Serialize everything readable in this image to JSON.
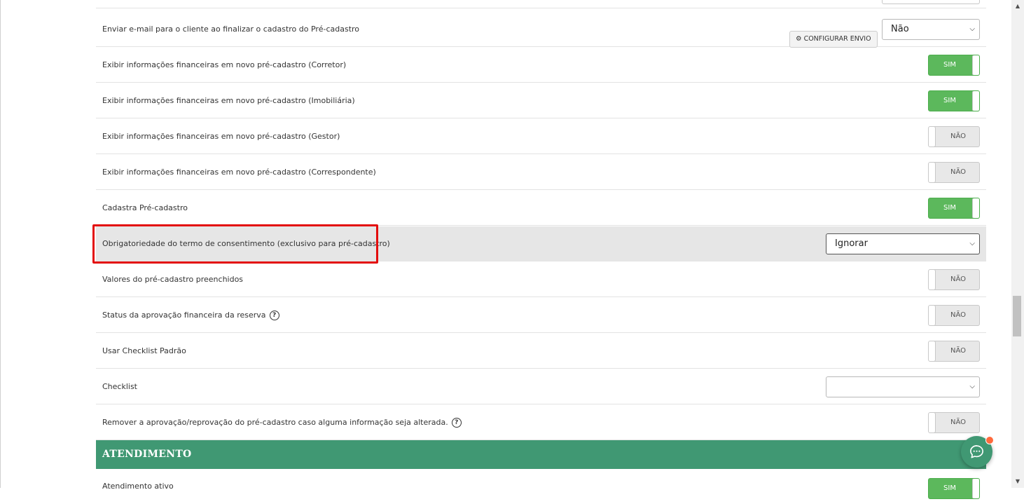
{
  "settings": [
    {
      "label": "Enviar e-mail para o cliente ao finalizar o cadastro do Pré-cadastro",
      "button": "CONFIGURAR ENVIO",
      "select": "Não"
    },
    {
      "label": "Exibir informações financeiras em novo pré-cadastro (Corretor)",
      "toggle": "SIM"
    },
    {
      "label": "Exibir informações financeiras em novo pré-cadastro (Imobiliária)",
      "toggle": "SIM"
    },
    {
      "label": "Exibir informações financeiras em novo pré-cadastro (Gestor)",
      "toggle": "NÃO"
    },
    {
      "label": "Exibir informações financeiras em novo pré-cadastro (Correspondente)",
      "toggle": "NÃO"
    },
    {
      "label": "Cadastra Pré-cadastro",
      "toggle": "SIM"
    },
    {
      "label": "Obrigatoriedade do termo de consentimento (exclusivo para pré-cadastro)",
      "select": "Ignorar"
    },
    {
      "label": "Valores do pré-cadastro preenchidos",
      "toggle": "NÃO"
    },
    {
      "label": "Status da aprovação financeira da reserva",
      "toggle": "NÃO",
      "help": "?"
    },
    {
      "label": "Usar Checklist Padrão",
      "toggle": "NÃO"
    },
    {
      "label": "Checklist",
      "select": ""
    },
    {
      "label": "Remover a aprovação/reprovação do pré-cadastro caso alguma informação seja alterada.",
      "toggle": "NÃO",
      "help": "?"
    }
  ],
  "section": {
    "title": "ATENDIMENTO"
  },
  "next_row": {
    "label": "Atendimento ativo",
    "toggle": "SIM"
  },
  "icons": {
    "gear": "gear-icon",
    "chevron": "chevron-down-icon",
    "help": "help-circle-icon",
    "chat": "chat-bubble-icon"
  },
  "colors": {
    "toggle_on": "#5cb85c",
    "section": "#409873",
    "highlight_box": "#e30d0d",
    "badge": "#ff6a3d"
  }
}
